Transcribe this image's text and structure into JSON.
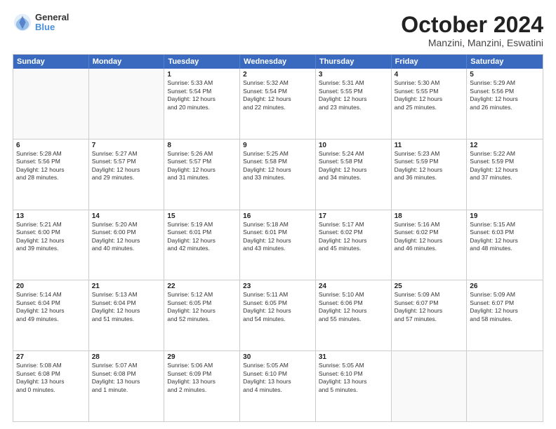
{
  "header": {
    "logo": {
      "line1": "General",
      "line2": "Blue"
    },
    "title": "October 2024",
    "subtitle": "Manzini, Manzini, Eswatini"
  },
  "calendar": {
    "days_of_week": [
      "Sunday",
      "Monday",
      "Tuesday",
      "Wednesday",
      "Thursday",
      "Friday",
      "Saturday"
    ],
    "rows": [
      [
        {
          "day": "",
          "info": ""
        },
        {
          "day": "",
          "info": ""
        },
        {
          "day": "1",
          "info": "Sunrise: 5:33 AM\nSunset: 5:54 PM\nDaylight: 12 hours\nand 20 minutes."
        },
        {
          "day": "2",
          "info": "Sunrise: 5:32 AM\nSunset: 5:54 PM\nDaylight: 12 hours\nand 22 minutes."
        },
        {
          "day": "3",
          "info": "Sunrise: 5:31 AM\nSunset: 5:55 PM\nDaylight: 12 hours\nand 23 minutes."
        },
        {
          "day": "4",
          "info": "Sunrise: 5:30 AM\nSunset: 5:55 PM\nDaylight: 12 hours\nand 25 minutes."
        },
        {
          "day": "5",
          "info": "Sunrise: 5:29 AM\nSunset: 5:56 PM\nDaylight: 12 hours\nand 26 minutes."
        }
      ],
      [
        {
          "day": "6",
          "info": "Sunrise: 5:28 AM\nSunset: 5:56 PM\nDaylight: 12 hours\nand 28 minutes."
        },
        {
          "day": "7",
          "info": "Sunrise: 5:27 AM\nSunset: 5:57 PM\nDaylight: 12 hours\nand 29 minutes."
        },
        {
          "day": "8",
          "info": "Sunrise: 5:26 AM\nSunset: 5:57 PM\nDaylight: 12 hours\nand 31 minutes."
        },
        {
          "day": "9",
          "info": "Sunrise: 5:25 AM\nSunset: 5:58 PM\nDaylight: 12 hours\nand 33 minutes."
        },
        {
          "day": "10",
          "info": "Sunrise: 5:24 AM\nSunset: 5:58 PM\nDaylight: 12 hours\nand 34 minutes."
        },
        {
          "day": "11",
          "info": "Sunrise: 5:23 AM\nSunset: 5:59 PM\nDaylight: 12 hours\nand 36 minutes."
        },
        {
          "day": "12",
          "info": "Sunrise: 5:22 AM\nSunset: 5:59 PM\nDaylight: 12 hours\nand 37 minutes."
        }
      ],
      [
        {
          "day": "13",
          "info": "Sunrise: 5:21 AM\nSunset: 6:00 PM\nDaylight: 12 hours\nand 39 minutes."
        },
        {
          "day": "14",
          "info": "Sunrise: 5:20 AM\nSunset: 6:00 PM\nDaylight: 12 hours\nand 40 minutes."
        },
        {
          "day": "15",
          "info": "Sunrise: 5:19 AM\nSunset: 6:01 PM\nDaylight: 12 hours\nand 42 minutes."
        },
        {
          "day": "16",
          "info": "Sunrise: 5:18 AM\nSunset: 6:01 PM\nDaylight: 12 hours\nand 43 minutes."
        },
        {
          "day": "17",
          "info": "Sunrise: 5:17 AM\nSunset: 6:02 PM\nDaylight: 12 hours\nand 45 minutes."
        },
        {
          "day": "18",
          "info": "Sunrise: 5:16 AM\nSunset: 6:02 PM\nDaylight: 12 hours\nand 46 minutes."
        },
        {
          "day": "19",
          "info": "Sunrise: 5:15 AM\nSunset: 6:03 PM\nDaylight: 12 hours\nand 48 minutes."
        }
      ],
      [
        {
          "day": "20",
          "info": "Sunrise: 5:14 AM\nSunset: 6:04 PM\nDaylight: 12 hours\nand 49 minutes."
        },
        {
          "day": "21",
          "info": "Sunrise: 5:13 AM\nSunset: 6:04 PM\nDaylight: 12 hours\nand 51 minutes."
        },
        {
          "day": "22",
          "info": "Sunrise: 5:12 AM\nSunset: 6:05 PM\nDaylight: 12 hours\nand 52 minutes."
        },
        {
          "day": "23",
          "info": "Sunrise: 5:11 AM\nSunset: 6:05 PM\nDaylight: 12 hours\nand 54 minutes."
        },
        {
          "day": "24",
          "info": "Sunrise: 5:10 AM\nSunset: 6:06 PM\nDaylight: 12 hours\nand 55 minutes."
        },
        {
          "day": "25",
          "info": "Sunrise: 5:09 AM\nSunset: 6:07 PM\nDaylight: 12 hours\nand 57 minutes."
        },
        {
          "day": "26",
          "info": "Sunrise: 5:09 AM\nSunset: 6:07 PM\nDaylight: 12 hours\nand 58 minutes."
        }
      ],
      [
        {
          "day": "27",
          "info": "Sunrise: 5:08 AM\nSunset: 6:08 PM\nDaylight: 13 hours\nand 0 minutes."
        },
        {
          "day": "28",
          "info": "Sunrise: 5:07 AM\nSunset: 6:08 PM\nDaylight: 13 hours\nand 1 minute."
        },
        {
          "day": "29",
          "info": "Sunrise: 5:06 AM\nSunset: 6:09 PM\nDaylight: 13 hours\nand 2 minutes."
        },
        {
          "day": "30",
          "info": "Sunrise: 5:05 AM\nSunset: 6:10 PM\nDaylight: 13 hours\nand 4 minutes."
        },
        {
          "day": "31",
          "info": "Sunrise: 5:05 AM\nSunset: 6:10 PM\nDaylight: 13 hours\nand 5 minutes."
        },
        {
          "day": "",
          "info": ""
        },
        {
          "day": "",
          "info": ""
        }
      ]
    ]
  }
}
